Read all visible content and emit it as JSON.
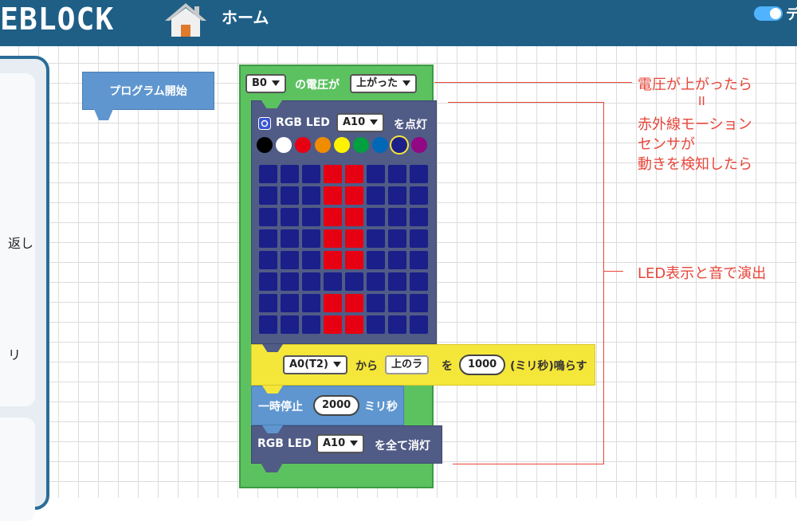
{
  "header": {
    "logo": "EBLOCK",
    "home_label": "ホーム",
    "toggle_label": "デ"
  },
  "left_panel": {
    "fragment_1": "返し",
    "fragment_2": "リ"
  },
  "start_block": {
    "label": "プログラム開始"
  },
  "trigger_block": {
    "pin": "B0",
    "text": "の電圧が",
    "condition": "上がった"
  },
  "rgb_block": {
    "label": "RGB LED",
    "pin": "A10",
    "suffix": "を点灯",
    "palette": [
      "#000000",
      "#ffffff",
      "#e60012",
      "#f08c00",
      "#fff200",
      "#00a040",
      "#0068b7",
      "#1d2088",
      "#920783"
    ],
    "selected_palette_index": 7,
    "led_off_color": "#1a1f8a",
    "led_on_color": "#e60012",
    "matrix": [
      [
        0,
        0,
        0,
        1,
        1,
        0,
        0,
        0
      ],
      [
        0,
        0,
        0,
        1,
        1,
        0,
        0,
        0
      ],
      [
        0,
        0,
        0,
        1,
        1,
        0,
        0,
        0
      ],
      [
        0,
        0,
        0,
        1,
        1,
        0,
        0,
        0
      ],
      [
        0,
        0,
        0,
        1,
        1,
        0,
        0,
        0
      ],
      [
        0,
        0,
        0,
        0,
        0,
        0,
        0,
        0
      ],
      [
        0,
        0,
        0,
        1,
        1,
        0,
        0,
        0
      ],
      [
        0,
        0,
        0,
        1,
        1,
        0,
        0,
        0
      ]
    ]
  },
  "buzzer_block": {
    "pin": "A0(T2)",
    "from": "から",
    "note": "上のラ",
    "wo": "を",
    "duration": "1000",
    "suffix": "(ミリ秒)鳴らす"
  },
  "wait_block": {
    "label": "一時停止",
    "value": "2000",
    "unit": "ミリ秒"
  },
  "off_block": {
    "label": "RGB LED",
    "pin": "A10",
    "suffix": "を全て消灯"
  },
  "annotations": {
    "line1": "電圧が上がったら",
    "line2": "II",
    "line3": "赤外線モーション",
    "line4": "センサが",
    "line5": "動きを検知したら",
    "led_sound": "LED表示と音で演出"
  },
  "colors": {
    "header": "#1f5f86",
    "annotation": "#e8463a",
    "block_green": "#5bc25f",
    "block_dark": "#505b86",
    "block_blue": "#5f96cf",
    "block_yellow": "#f5e63a"
  }
}
